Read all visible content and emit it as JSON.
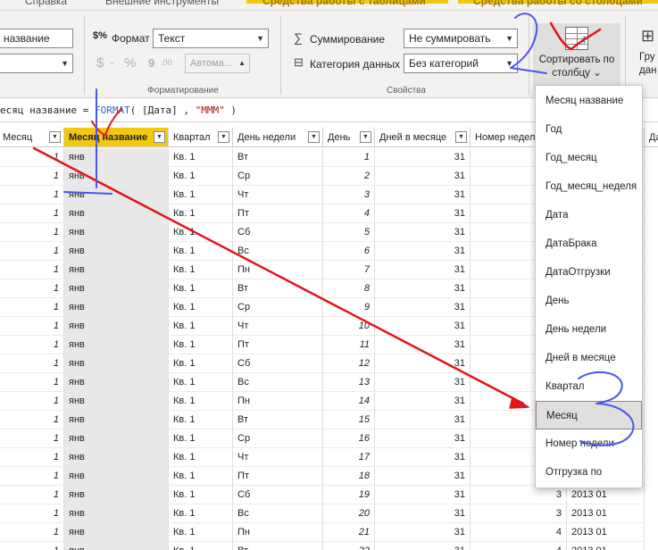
{
  "ribbon_tabs": {
    "help": "Справка",
    "external_tools": "Внешние инструменты",
    "table_tools": "Средства работы с таблицами",
    "column_tools": "Средства работы со столбцами"
  },
  "structure": {
    "name_value": "название",
    "dropdown_value": ""
  },
  "formatting": {
    "format_label": "Формат",
    "format_value": "Текст",
    "currency_icon": "$",
    "percent_icon": "%",
    "comma_icon": "9",
    "decimal_icon": ".00",
    "auto_value": "Автома...",
    "group_label": "Форматирование"
  },
  "properties": {
    "summarize_label": "Суммирование",
    "summarize_value": "Не суммировать",
    "category_label": "Категория данных",
    "category_value": "Без категорий",
    "group_label": "Свойства"
  },
  "sort": {
    "label_line1": "Сортировать по",
    "label_line2": "столбцу ⌄"
  },
  "group_button": {
    "label_line1": "Гру",
    "label_line2": "дан"
  },
  "formula": {
    "prefix": "есяц название = ",
    "fn": "FORMAT",
    "args_a": "( [Дата] , ",
    "str": "\"МММ\"",
    "args_b": " )"
  },
  "table": {
    "headers": [
      "Месяц",
      "Месяц название",
      "Квартал",
      "День недели",
      "День",
      "Дней в месяце",
      "Номер недели",
      "",
      "Да"
    ],
    "rows": [
      [
        "1",
        "янв",
        "Кв. 1",
        "Вт",
        "1",
        "31"
      ],
      [
        "1",
        "янв",
        "Кв. 1",
        "Ср",
        "2",
        "31"
      ],
      [
        "1",
        "янв",
        "Кв. 1",
        "Чт",
        "3",
        "31"
      ],
      [
        "1",
        "янв",
        "Кв. 1",
        "Пт",
        "4",
        "31"
      ],
      [
        "1",
        "янв",
        "Кв. 1",
        "Сб",
        "5",
        "31"
      ],
      [
        "1",
        "янв",
        "Кв. 1",
        "Вс",
        "6",
        "31"
      ],
      [
        "1",
        "янв",
        "Кв. 1",
        "Пн",
        "7",
        "31"
      ],
      [
        "1",
        "янв",
        "Кв. 1",
        "Вт",
        "8",
        "31"
      ],
      [
        "1",
        "янв",
        "Кв. 1",
        "Ср",
        "9",
        "31"
      ],
      [
        "1",
        "янв",
        "Кв. 1",
        "Чт",
        "10",
        "31"
      ],
      [
        "1",
        "янв",
        "Кв. 1",
        "Пт",
        "11",
        "31"
      ],
      [
        "1",
        "янв",
        "Кв. 1",
        "Сб",
        "12",
        "31"
      ],
      [
        "1",
        "янв",
        "Кв. 1",
        "Вс",
        "13",
        "31"
      ],
      [
        "1",
        "янв",
        "Кв. 1",
        "Пн",
        "14",
        "31"
      ],
      [
        "1",
        "янв",
        "Кв. 1",
        "Вт",
        "15",
        "31"
      ],
      [
        "1",
        "янв",
        "Кв. 1",
        "Ср",
        "16",
        "31"
      ],
      [
        "1",
        "янв",
        "Кв. 1",
        "Чт",
        "17",
        "31"
      ],
      [
        "1",
        "янв",
        "Кв. 1",
        "Пт",
        "18",
        "31"
      ],
      [
        "1",
        "янв",
        "Кв. 1",
        "Сб",
        "19",
        "31",
        "3",
        "2013 01"
      ],
      [
        "1",
        "янв",
        "Кв. 1",
        "Вс",
        "20",
        "31",
        "3",
        "2013 01"
      ],
      [
        "1",
        "янв",
        "Кв. 1",
        "Пн",
        "21",
        "31",
        "4",
        "2013 01"
      ],
      [
        "1",
        "янв",
        "Кв. 1",
        "Вт",
        "22",
        "31",
        "4",
        "2013 01"
      ]
    ]
  },
  "sort_dropdown": {
    "items": [
      "Месяц название",
      "Год",
      "Год_месяц",
      "Год_месяц_неделя",
      "Дата",
      "ДатаБрака",
      "ДатаОтгрузки",
      "День",
      "День недели",
      "Дней в месяце",
      "Квартал",
      "Месяц",
      "Номер недели",
      "Отгрузка по"
    ],
    "highlighted": "Месяц"
  },
  "annotations": {
    "red_color": "#e0161b",
    "blue_color": "#4b57e6"
  }
}
